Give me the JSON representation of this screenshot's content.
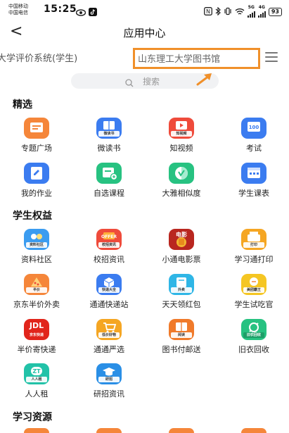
{
  "status_bar": {
    "carrier_1": "中国移动",
    "carrier_2": "中国电信",
    "time": "15:25",
    "network_1": "5G",
    "network_2": "4G",
    "battery": "93"
  },
  "header": {
    "back_glyph": "<",
    "title": "应用中心"
  },
  "tabs": {
    "tab_1": "大学评价系统(学生)",
    "tab_2": "山东理工大学图书馆"
  },
  "search": {
    "placeholder": "搜索"
  },
  "colors": {
    "highlight_box": "#f0902a",
    "blue": "#3b7cf0",
    "orange": "#f5863a",
    "green": "#27c281",
    "red": "#ef4b3b"
  },
  "sections": {
    "featured": {
      "title": "精选",
      "items": [
        {
          "label": "专题广场",
          "icon": "square-icon",
          "tag": ""
        },
        {
          "label": "微读书",
          "icon": "book-icon",
          "tag": "微读书"
        },
        {
          "label": "知视频",
          "icon": "video-icon",
          "tag": "知视频"
        },
        {
          "label": "考试",
          "icon": "exam-icon",
          "tag": "100"
        },
        {
          "label": "我的作业",
          "icon": "homework-icon",
          "tag": ""
        },
        {
          "label": "自选课程",
          "icon": "course-icon",
          "tag": ""
        },
        {
          "label": "大雅相似度",
          "icon": "similarity-icon",
          "tag": ""
        },
        {
          "label": "学生课表",
          "icon": "schedule-icon",
          "tag": ""
        }
      ]
    },
    "benefits": {
      "title": "学生权益",
      "items": [
        {
          "label": "资料社区",
          "icon": "materials-icon",
          "tag": "资料社区"
        },
        {
          "label": "校招资讯",
          "icon": "recruit-icon",
          "tag": "校招资讯"
        },
        {
          "label": "小通电影票",
          "icon": "movie-icon",
          "tag": "电影"
        },
        {
          "label": "学习通打印",
          "icon": "print-icon",
          "tag": "打印"
        },
        {
          "label": "京东半价外卖",
          "icon": "takeout-icon",
          "tag": "半价"
        },
        {
          "label": "通通快递站",
          "icon": "express-icon",
          "tag": "快递大全"
        },
        {
          "label": "天天领红包",
          "icon": "redpacket-icon",
          "tag": "外卖"
        },
        {
          "label": "学生试吃官",
          "icon": "foodtaster-icon",
          "tag": "美团霸王"
        },
        {
          "label": "半价寄快递",
          "icon": "jd-express-icon",
          "tag": "京东快递"
        },
        {
          "label": "通通严选",
          "icon": "cart-icon",
          "tag": "低价好物"
        },
        {
          "label": "图书付邮送",
          "icon": "bookmail-icon",
          "tag": "阅读"
        },
        {
          "label": "旧衣回收",
          "icon": "recycle-icon",
          "tag": "旧衣回收"
        },
        {
          "label": "人人租",
          "icon": "rent-icon",
          "tag": "人人租"
        },
        {
          "label": "研招资讯",
          "icon": "graduate-icon",
          "tag": "研招"
        }
      ]
    },
    "resources": {
      "title": "学习资源"
    }
  }
}
